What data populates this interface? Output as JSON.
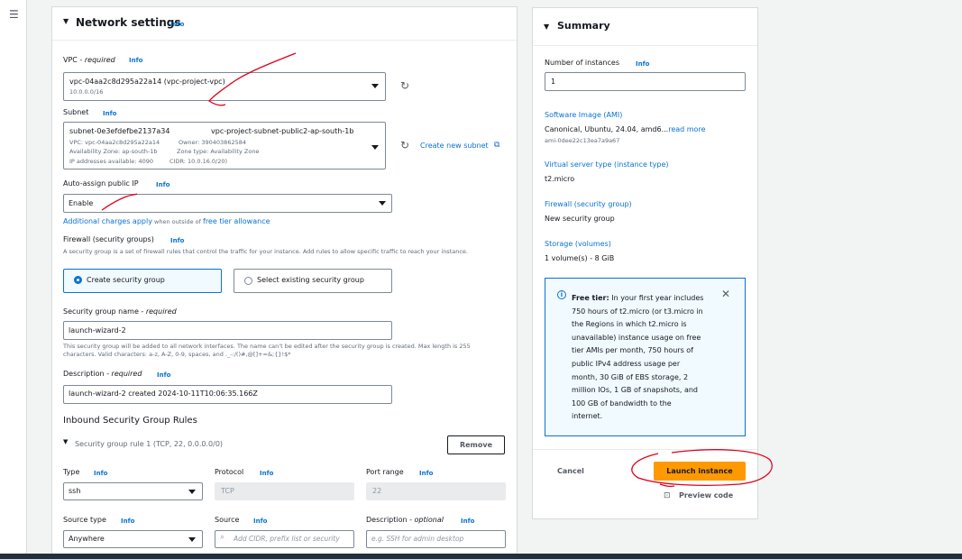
{
  "network": {
    "title": "Network settings",
    "info": "Info",
    "vpc_label": "VPC",
    "vpc_required": " - required",
    "vpc_value": "vpc-04aa2c8d295a22a14 (vpc-project-vpc)",
    "vpc_cidr": "10.0.0.0/16",
    "subnet_label": "Subnet",
    "subnet_id": "subnet-0e3efdefbe2137a34",
    "subnet_name": "vpc-project-subnet-public2-ap-south-1b",
    "subnet_vpc": "VPC: vpc-04aa2c8d295a22a14",
    "subnet_owner": "Owner: 390403862584",
    "subnet_az": "Availability Zone: ap-south-1b",
    "subnet_zone_type": "Zone type: Availability Zone",
    "subnet_ips": "IP addresses available: 4090",
    "subnet_cidr": "CIDR: 10.0.16.0/20)",
    "create_subnet": "Create new subnet",
    "auto_ip_label": "Auto-assign public IP",
    "auto_ip_value": "Enable",
    "charges_link": "Additional charges apply",
    "charges_mid": " when outside of ",
    "free_tier_link": "free tier allowance",
    "firewall_label": "Firewall (security groups)",
    "firewall_desc": "A security group is a set of firewall rules that control the traffic for your instance. Add rules to allow specific traffic to reach your instance.",
    "create_sg": "Create security group",
    "select_sg": "Select existing security group",
    "sg_name_label": "Security group name",
    "sg_name_required": " - required",
    "sg_name_value": "launch-wizard-2",
    "sg_name_help": "This security group will be added to all network interfaces. The name can't be edited after the security group is created. Max length is 255 characters. Valid characters: a-z, A-Z, 0-9, spaces, and ._-:/()#,@[]+=&;{}!$*",
    "desc_label": "Description",
    "desc_required": " - required",
    "desc_value": "launch-wizard-2 created 2024-10-11T10:06:35.166Z",
    "inbound_title": "Inbound Security Group Rules",
    "rule_title": "Security group rule 1 (TCP, 22, 0.0.0.0/0)",
    "remove": "Remove",
    "type_label": "Type",
    "type_value": "ssh",
    "protocol_label": "Protocol",
    "protocol_value": "TCP",
    "port_label": "Port range",
    "port_value": "22",
    "source_type_label": "Source type",
    "source_type_value": "Anywhere",
    "source_label": "Source",
    "source_placeholder": "Add CIDR, prefix list or security",
    "rule_desc_label": "Description",
    "rule_desc_optional": " - optional",
    "rule_desc_placeholder": "e.g. SSH for admin desktop"
  },
  "summary": {
    "title": "Summary",
    "instances_label": "Number of instances",
    "instances_value": "1",
    "ami_label": "Software Image (AMI)",
    "ami_value": "Canonical, Ubuntu, 24.04, amd6...",
    "read_more": "read more",
    "ami_id": "ami-0dee22c13ea7a9a67",
    "type_label": "Virtual server type (instance type)",
    "type_value": "t2.micro",
    "firewall_label": "Firewall (security group)",
    "firewall_value": "New security group",
    "storage_label": "Storage (volumes)",
    "storage_value": "1 volume(s) - 8 GiB",
    "free_tier_bold": "Free tier:",
    "free_tier_lines": [
      " In your first year includes",
      "750 hours of t2.micro (or t3.micro in",
      "the Regions in which t2.micro is",
      "unavailable) instance usage on free",
      "tier AMIs per month, 750 hours of",
      "public IPv4 address usage per",
      "month, 30 GiB of EBS storage, 2",
      "million IOs, 1 GB of snapshots, and",
      "100 GB of bandwidth to the",
      "internet."
    ],
    "cancel": "Cancel",
    "launch": "Launch instance",
    "preview": "Preview code"
  },
  "colors": {
    "accent": "#0972d3",
    "launch": "#ff9900",
    "annotation": "#e0001b"
  }
}
